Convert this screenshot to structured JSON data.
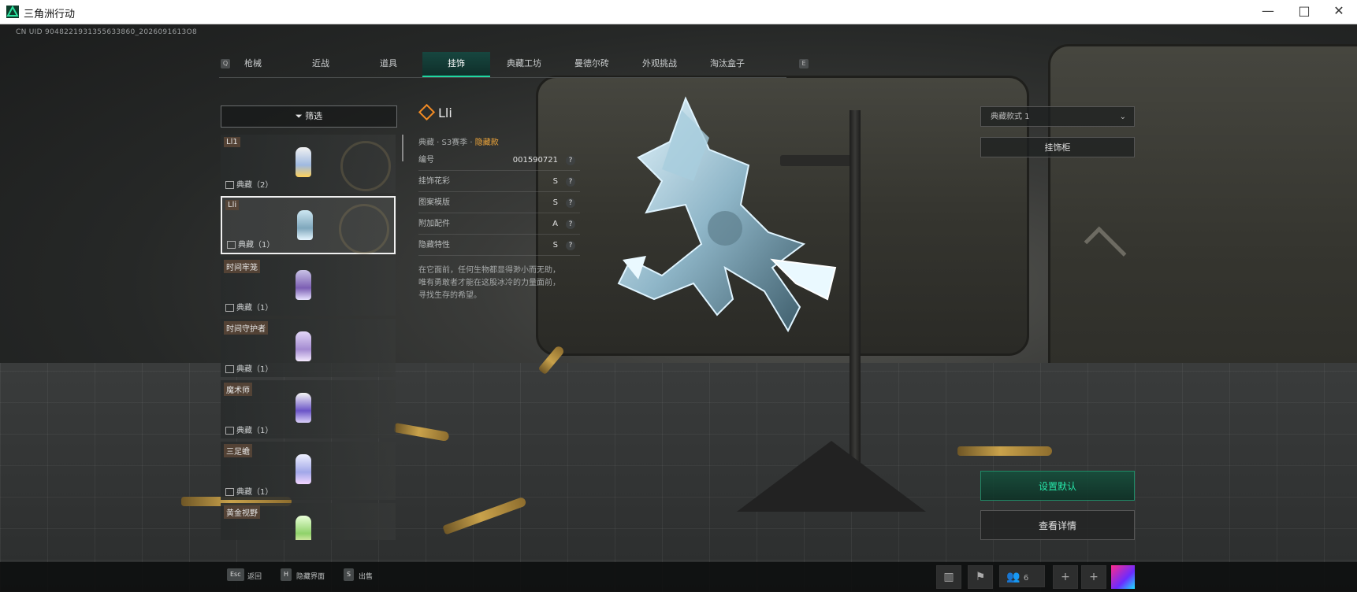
{
  "window": {
    "title": "三角洲行动",
    "controls": [
      "—",
      "□",
      "✕"
    ]
  },
  "uid": "CN UID 9048221931355633860_2026091613O8",
  "tabs": {
    "left_key": "Q",
    "right_key": "E",
    "items": [
      {
        "label": "枪械",
        "active": false
      },
      {
        "label": "近战",
        "active": false
      },
      {
        "label": "道具",
        "active": false
      },
      {
        "label": "挂饰",
        "active": true
      },
      {
        "label": "典藏工坊",
        "active": false
      },
      {
        "label": "曼德尔砖",
        "active": false
      },
      {
        "label": "外观挑战",
        "active": false
      },
      {
        "label": "淘汰盒子",
        "active": false
      }
    ]
  },
  "filter": {
    "label": "筛选"
  },
  "list": [
    {
      "name": "Ll1",
      "badge": "典藏（2）",
      "selected": false
    },
    {
      "name": "Lli",
      "badge": "典藏（1）",
      "selected": true
    },
    {
      "name": "时间牢笼",
      "badge": "典藏（1）",
      "selected": false
    },
    {
      "name": "时间守护者",
      "badge": "典藏（1）",
      "selected": false
    },
    {
      "name": "魔术师",
      "badge": "典藏（1）",
      "selected": false
    },
    {
      "name": "三足蟾",
      "badge": "典藏（1）",
      "selected": false
    },
    {
      "name": "黄金视野",
      "badge": "",
      "selected": false
    }
  ],
  "detail": {
    "name": "Lli",
    "subtitle_prefix": "典藏 · S3赛季 · ",
    "subtitle_highlight": "隐藏款",
    "attributes": [
      {
        "label": "编号",
        "value": "001590721"
      },
      {
        "label": "挂饰花彩",
        "value": "S"
      },
      {
        "label": "图案模版",
        "value": "S"
      },
      {
        "label": "附加配件",
        "value": "A"
      },
      {
        "label": "隐藏特性",
        "value": "S"
      }
    ],
    "description_lines": [
      "在它面前，任何生物都显得渺小而无助，",
      "唯有勇敢者才能在这股冰冷的力量面前，",
      "寻找生存的希望。"
    ]
  },
  "right": {
    "style_dropdown": "典藏款式 1",
    "cabinet_button": "挂饰柜",
    "default_button": "设置默认",
    "details_button": "查看详情"
  },
  "bottom": {
    "keys": [
      {
        "key": "Esc",
        "label": "返回"
      },
      {
        "key": "H",
        "label": "隐藏界面"
      },
      {
        "key": "S",
        "label": "出售"
      }
    ],
    "friends_count": "6"
  },
  "colors": {
    "accent": "#1fd7a1",
    "highlight": "#f0a63a",
    "rarity_icon": "#f08a24"
  }
}
